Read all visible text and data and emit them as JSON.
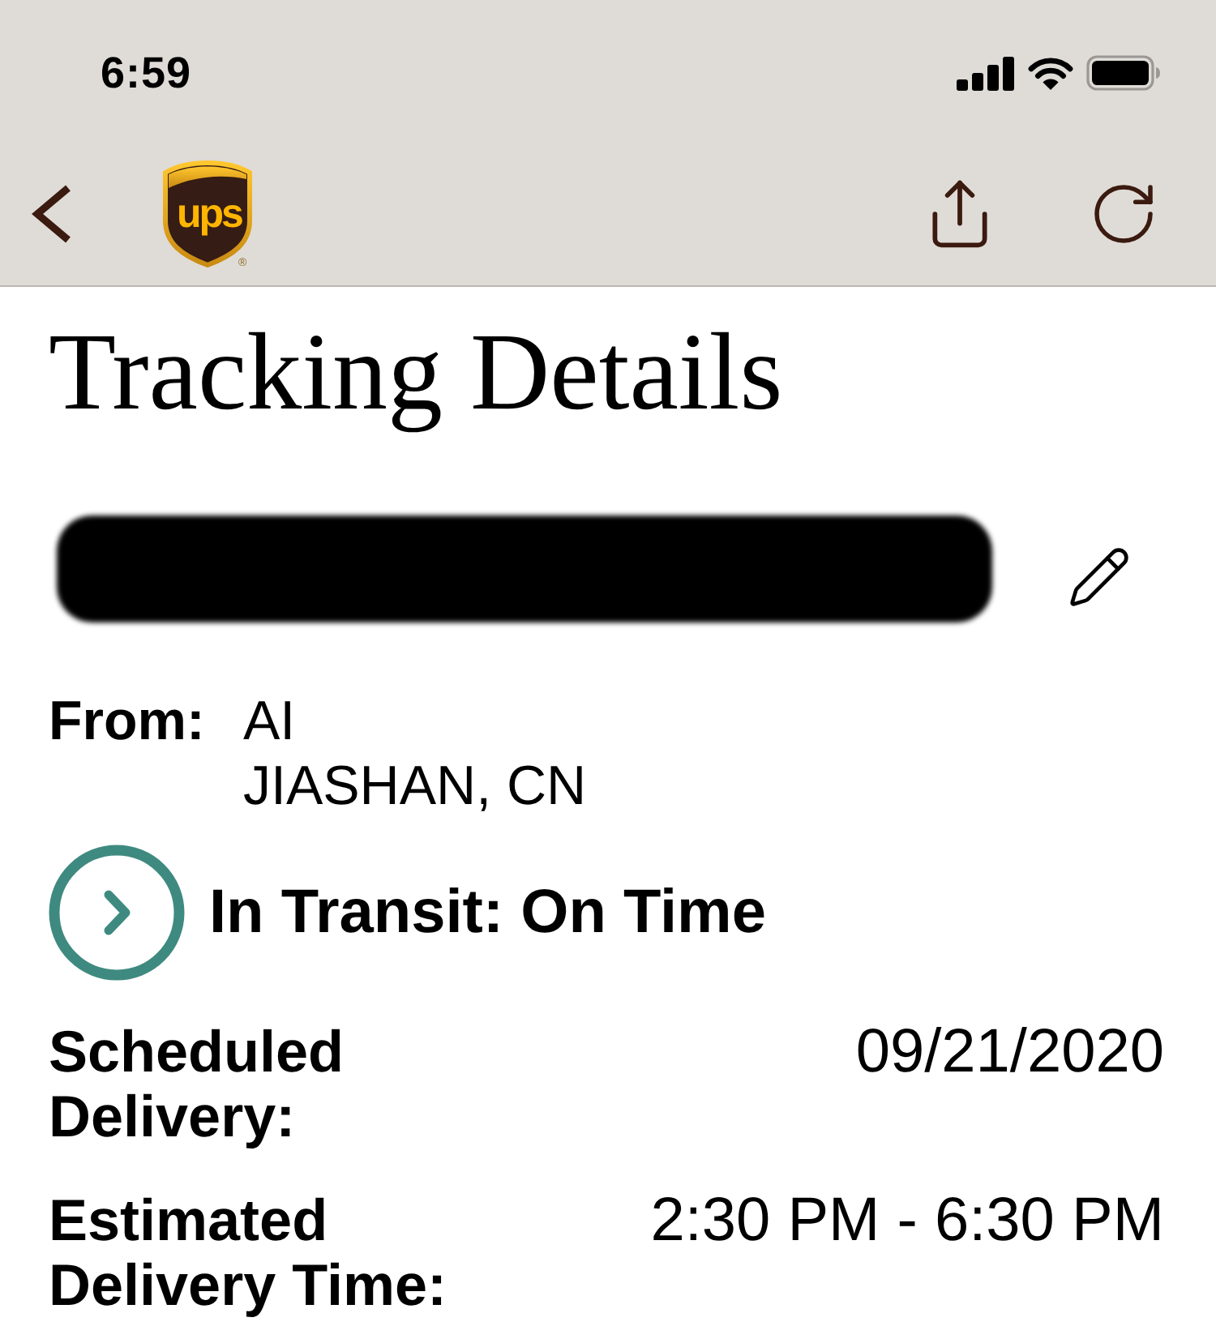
{
  "status_bar": {
    "time": "6:59"
  },
  "nav_bar": {
    "logo": {
      "text": "ups",
      "registered_mark": "®"
    }
  },
  "page": {
    "title": "Tracking Details",
    "tracking_number": {
      "redacted": true
    },
    "from": {
      "label": "From:",
      "name": "AI",
      "location": "JIASHAN, CN"
    },
    "status": {
      "text": "In Transit: On Time"
    },
    "details": [
      {
        "label": "Scheduled Delivery:",
        "value": "09/21/2020"
      },
      {
        "label": "Estimated Delivery Time:",
        "value": "2:30 PM - 6:30 PM"
      }
    ]
  }
}
